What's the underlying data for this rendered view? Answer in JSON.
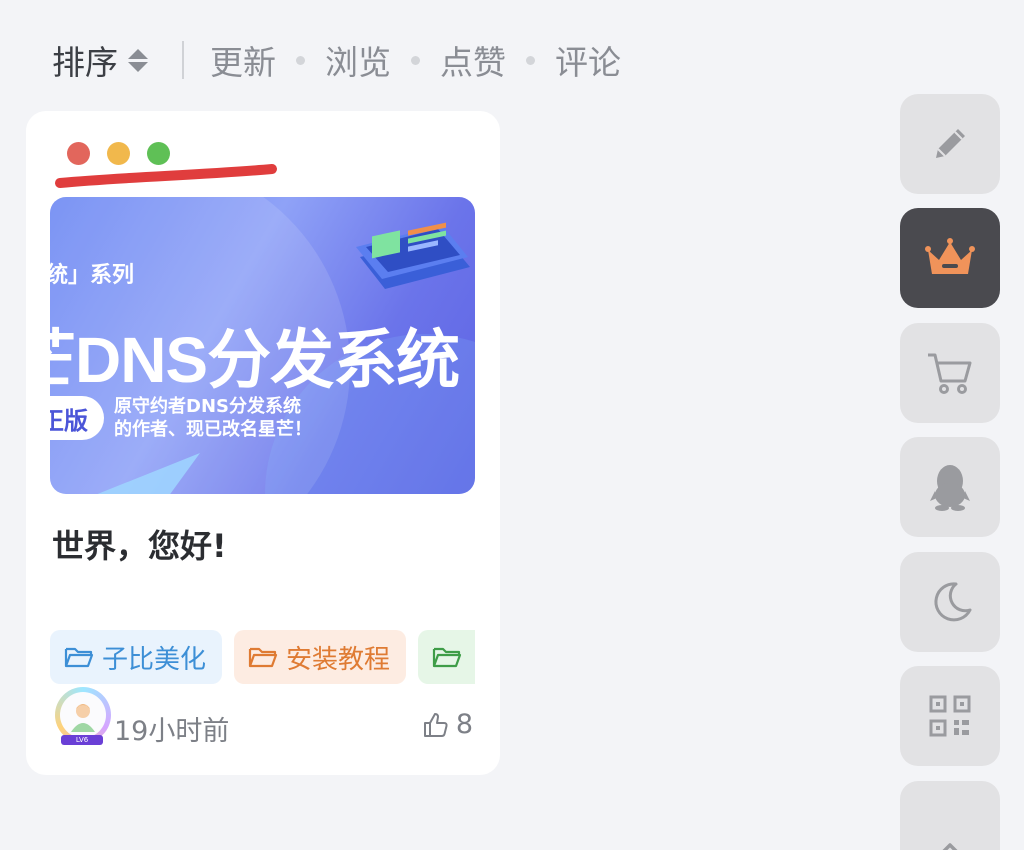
{
  "sortbar": {
    "label": "排序",
    "options": [
      "更新",
      "浏览",
      "点赞",
      "评论"
    ]
  },
  "post": {
    "cover": {
      "series_text": "统」系列",
      "headline": "芒DNS分发系统",
      "pill_text": "正版",
      "desc_line1": "原守约者DNS分发系统",
      "desc_line2": "的作者、现已改名星芒！"
    },
    "title": "世界，您好!",
    "tags": [
      {
        "label": "子比美化",
        "color": "#3d8fd6"
      },
      {
        "label": "安装教程",
        "color": "#df7b33"
      },
      {
        "label": "",
        "color": "#3f9d48"
      }
    ],
    "avatar_badge": "LV6",
    "time": "19小时前",
    "likes": "8",
    "mac_dots": [
      "#e2665c",
      "#f1b84c",
      "#5fc056"
    ],
    "underline_color": "#e03d3d"
  },
  "toolbar": {
    "items": [
      {
        "icon": "pencil-icon"
      },
      {
        "icon": "crown-icon",
        "active": true
      },
      {
        "icon": "cart-icon"
      },
      {
        "icon": "qq-penguin-icon"
      },
      {
        "icon": "moon-icon"
      },
      {
        "icon": "qrcode-icon"
      },
      {
        "icon": "chevron-up-icon"
      }
    ]
  }
}
